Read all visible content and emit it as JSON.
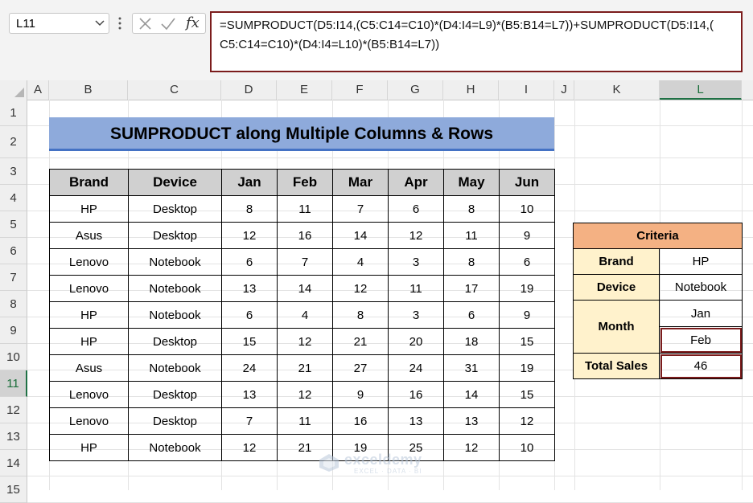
{
  "name_box": {
    "value": "L11"
  },
  "formula_bar": {
    "fx_label": "fx",
    "line1": "=SUMPRODUCT(D5:I14,(C5:C14=C10)*(D4:I4=L9)*(B5:B14=L7))+SUMPRODUCT(D5:I14,(",
    "line2": "C5:C14=C10)*(D4:I4=L10)*(B5:B14=L7))"
  },
  "column_headers": [
    "A",
    "B",
    "C",
    "D",
    "E",
    "F",
    "G",
    "H",
    "I",
    "J",
    "K",
    "L"
  ],
  "row_headers": [
    "1",
    "2",
    "3",
    "4",
    "5",
    "6",
    "7",
    "8",
    "9",
    "10",
    "11",
    "12",
    "13",
    "14",
    "15"
  ],
  "title": "SUMPRODUCT along Multiple Columns & Rows",
  "table": {
    "headers": [
      "Brand",
      "Device",
      "Jan",
      "Feb",
      "Mar",
      "Apr",
      "May",
      "Jun"
    ],
    "rows": [
      [
        "HP",
        "Desktop",
        "8",
        "11",
        "7",
        "6",
        "8",
        "10"
      ],
      [
        "Asus",
        "Desktop",
        "12",
        "16",
        "14",
        "12",
        "11",
        "9"
      ],
      [
        "Lenovo",
        "Notebook",
        "6",
        "7",
        "4",
        "3",
        "8",
        "6"
      ],
      [
        "Lenovo",
        "Notebook",
        "13",
        "14",
        "12",
        "11",
        "17",
        "19"
      ],
      [
        "HP",
        "Notebook",
        "6",
        "4",
        "8",
        "3",
        "6",
        "9"
      ],
      [
        "HP",
        "Desktop",
        "15",
        "12",
        "21",
        "20",
        "18",
        "15"
      ],
      [
        "Asus",
        "Notebook",
        "24",
        "21",
        "27",
        "24",
        "31",
        "19"
      ],
      [
        "Lenovo",
        "Desktop",
        "13",
        "12",
        "9",
        "16",
        "14",
        "15"
      ],
      [
        "Lenovo",
        "Desktop",
        "7",
        "11",
        "16",
        "13",
        "13",
        "12"
      ],
      [
        "HP",
        "Notebook",
        "12",
        "21",
        "19",
        "25",
        "12",
        "10"
      ]
    ]
  },
  "criteria": {
    "header": "Criteria",
    "brand_label": "Brand",
    "brand_value": "HP",
    "device_label": "Device",
    "device_value": "Notebook",
    "month_label": "Month",
    "month_value_1": "Jan",
    "month_value_2": "Feb",
    "total_label": "Total Sales",
    "total_value": "46"
  },
  "watermark": {
    "name": "exceldemy",
    "tagline": "EXCEL · DATA · BI"
  },
  "colors": {
    "title_bg": "#8eaadb",
    "criteria_header": "#f4b183",
    "criteria_label": "#fff2cc",
    "selection": "#7b1c1c"
  }
}
